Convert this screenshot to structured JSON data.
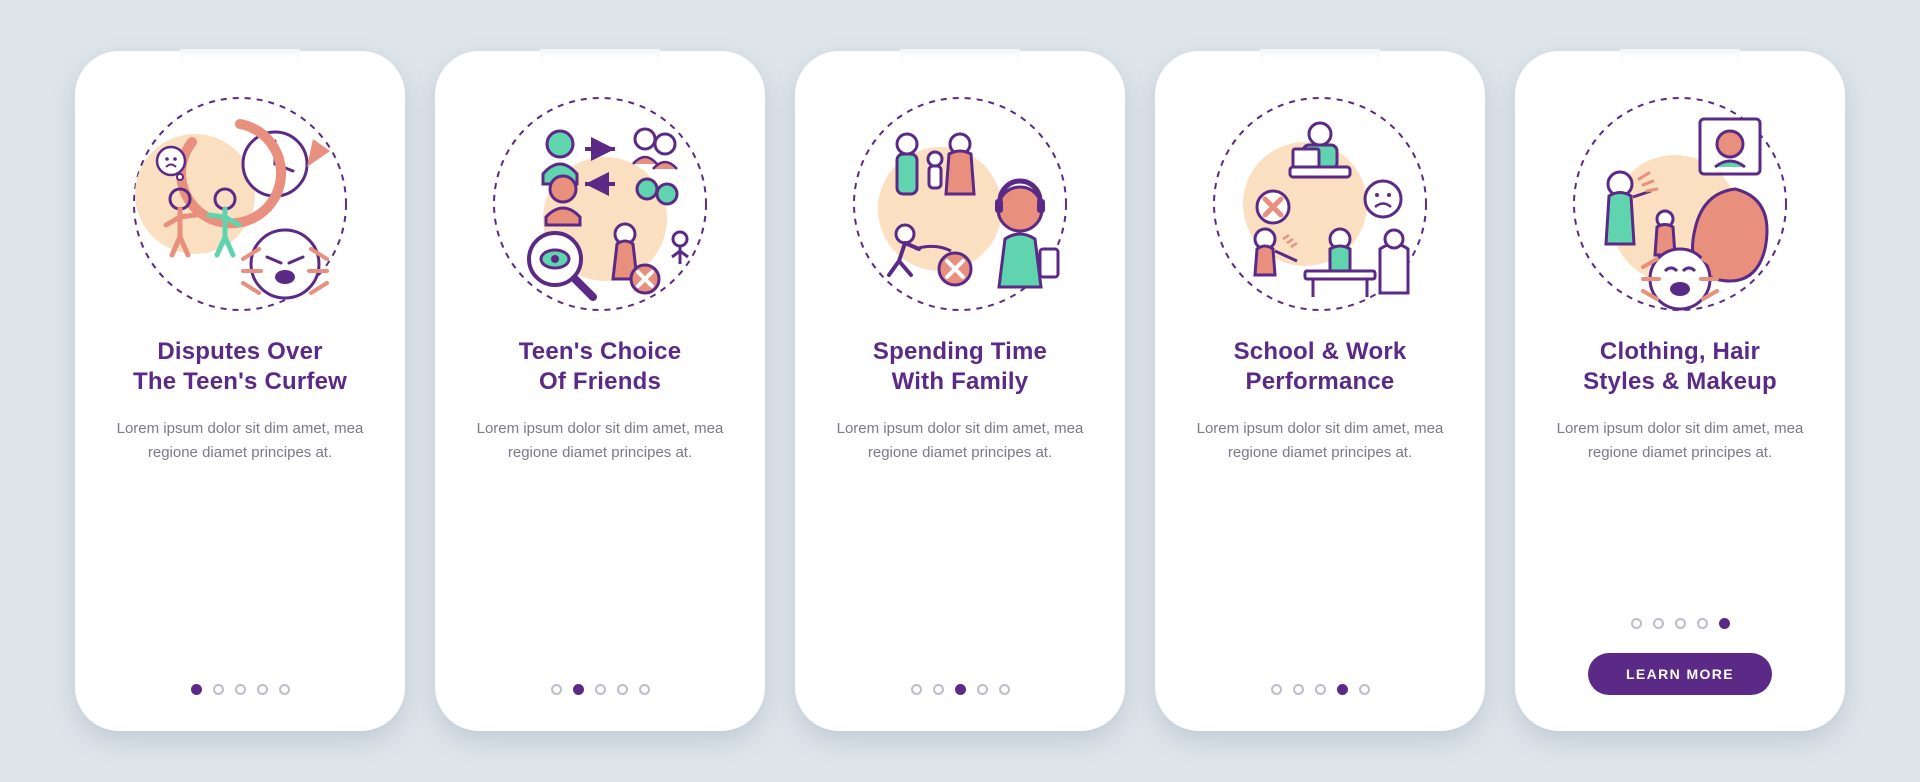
{
  "colors": {
    "bg": "#dde5ea",
    "card": "#ffffff",
    "primary": "#5b2a86",
    "coral": "#e88f7d",
    "mint": "#5fd4af",
    "cream": "#fae0c0",
    "grayText": "#7a7a8a",
    "dotInactive": "#bdbdc9"
  },
  "button_label": "LEARN MORE",
  "lorem": "Lorem ipsum dolor sit dim amet, mea regione diamet principes at.",
  "screens": [
    {
      "title": "Disputes Over\nThe Teen's Curfew",
      "icon": "curfew"
    },
    {
      "title": "Teen's Choice\nOf Friends",
      "icon": "friends"
    },
    {
      "title": "Spending Time\nWith Family",
      "icon": "family"
    },
    {
      "title": "School & Work\nPerformance",
      "icon": "school"
    },
    {
      "title": "Clothing, Hair\nStyles & Makeup",
      "icon": "style"
    }
  ]
}
